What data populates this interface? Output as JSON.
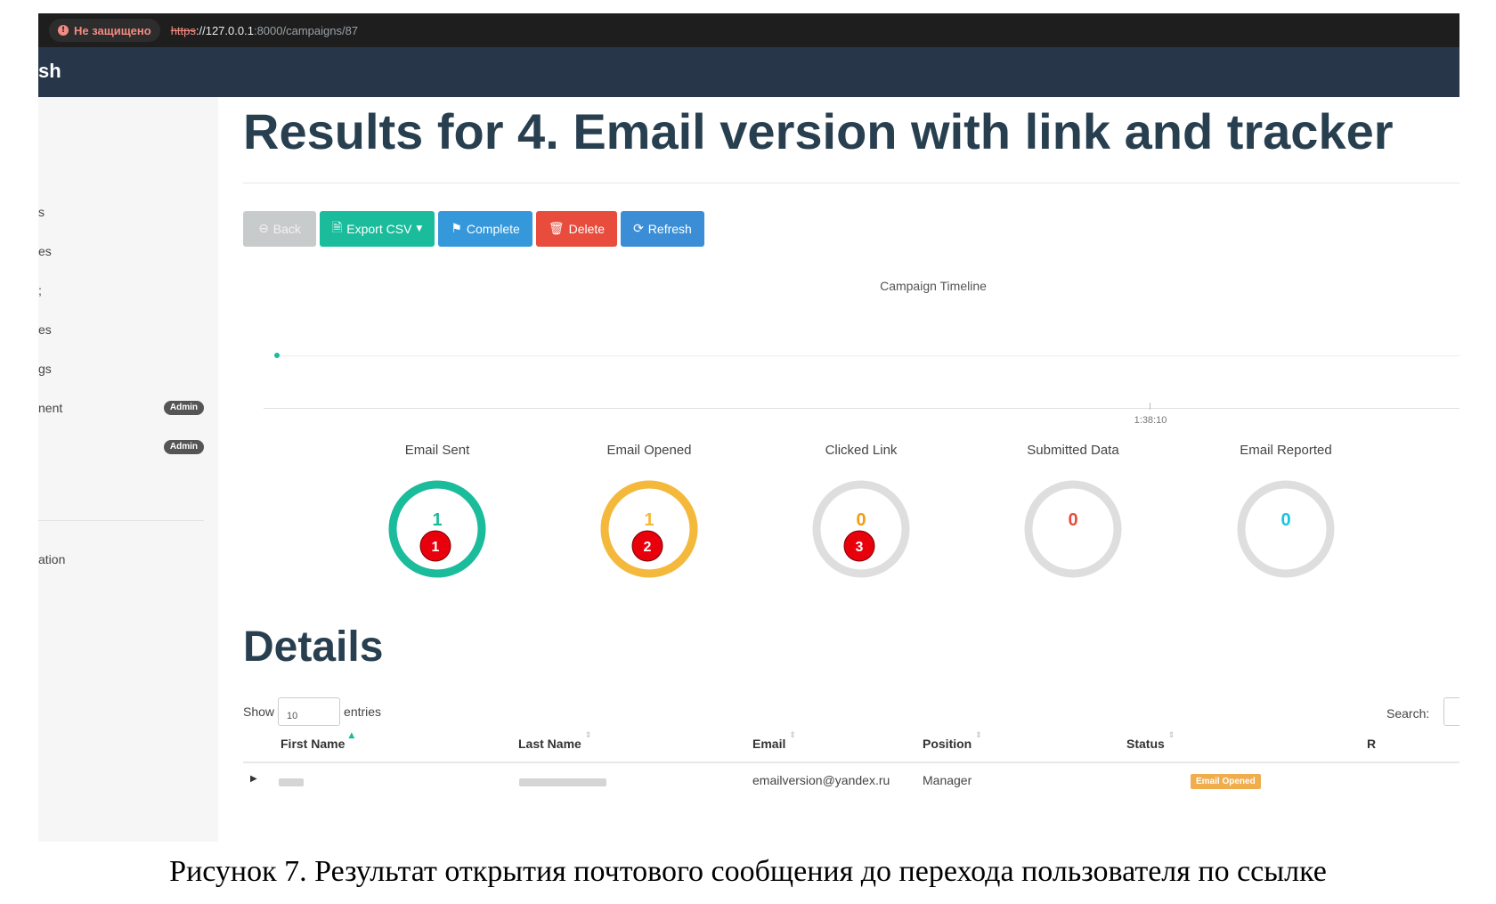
{
  "browser": {
    "security_label": "Не защищено",
    "url_scheme": "https",
    "url_host": "://127.0.0.1",
    "url_rest": ":8000/campaigns/87"
  },
  "navbar": {
    "brand": "sh"
  },
  "sidebar": {
    "items": [
      {
        "label": "s"
      },
      {
        "label": "es"
      },
      {
        "label": ";"
      },
      {
        "label": "es"
      },
      {
        "label": "gs"
      },
      {
        "label": "nent",
        "badge": "Admin"
      },
      {
        "label": "",
        "badge": "Admin"
      },
      {
        "label": "ation"
      }
    ]
  },
  "page": {
    "title": "Results for 4. Email version with link and tracker"
  },
  "buttons": {
    "back": "Back",
    "export": "Export CSV",
    "complete": "Complete",
    "delete": "Delete",
    "refresh": "Refresh"
  },
  "timeline": {
    "title": "Campaign Timeline",
    "tick_label": "1:38:10"
  },
  "stats": [
    {
      "label": "Email Sent",
      "value": "1",
      "fraction": 1,
      "color": "#1abc9c",
      "marker": "1"
    },
    {
      "label": "Email Opened",
      "value": "1",
      "fraction": 1,
      "color": "#f4b93b",
      "marker": "2"
    },
    {
      "label": "Clicked Link",
      "value": "0",
      "fraction": 0,
      "color": "#f39c12",
      "marker": "3"
    },
    {
      "label": "Submitted Data",
      "value": "0",
      "fraction": 0,
      "color": "#e74c3c",
      "marker": ""
    },
    {
      "label": "Email Reported",
      "value": "0",
      "fraction": 0,
      "color": "#17c4e0",
      "marker": ""
    }
  ],
  "colors": {
    "ring_track": "#dedede",
    "marker_fill": "#e8000d"
  },
  "details": {
    "title": "Details",
    "show_label": "Show",
    "entries_value": "10",
    "entries_label": "entries",
    "search_label": "Search:",
    "columns": [
      "First Name",
      "Last Name",
      "Email",
      "Position",
      "Status",
      "R"
    ],
    "row": {
      "email": "emailversion@yandex.ru",
      "position": "Manager",
      "status": "Email Opened"
    }
  },
  "caption": "Рисунок 7. Результат открытия почтового сообщения до перехода пользователя по ссылке"
}
